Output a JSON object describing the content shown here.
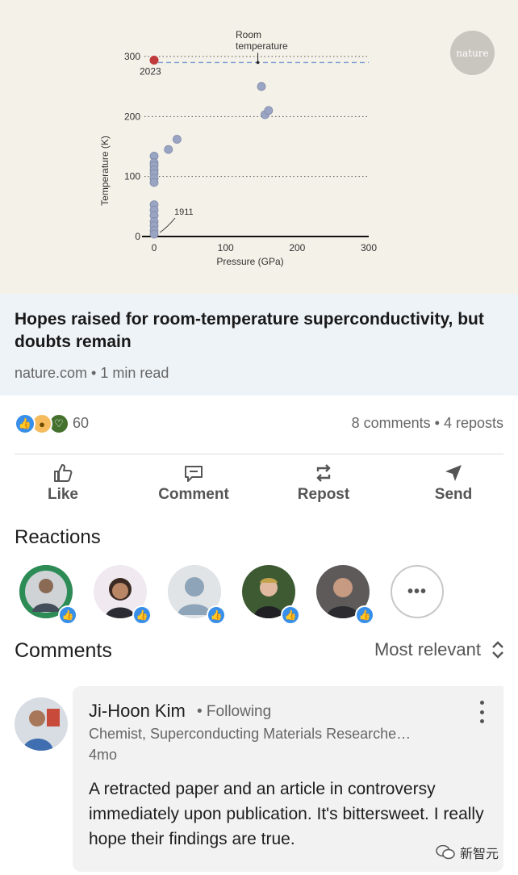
{
  "chart_data": {
    "type": "scatter",
    "xlabel": "Pressure (GPa)",
    "ylabel": "Temperature (K)",
    "xlim": [
      0,
      300
    ],
    "ylim": [
      0,
      300
    ],
    "x_ticks": [
      "0",
      "100",
      "200",
      "300"
    ],
    "y_ticks": [
      "0",
      "100",
      "200",
      "300"
    ],
    "grid": "dotted horizontal at 100, 200, 300",
    "reference_line": {
      "label": "Room temperature",
      "y": 290
    },
    "annotations": [
      {
        "label": "2023",
        "x": 0,
        "y": 294
      },
      {
        "label": "1911",
        "x": 0,
        "y": 4
      }
    ],
    "points": [
      {
        "x": 0,
        "y": 294,
        "highlight": true
      },
      {
        "x": 0,
        "y": 134
      },
      {
        "x": 0,
        "y": 123
      },
      {
        "x": 0,
        "y": 118
      },
      {
        "x": 0,
        "y": 111
      },
      {
        "x": 0,
        "y": 105
      },
      {
        "x": 0,
        "y": 97
      },
      {
        "x": 0,
        "y": 90
      },
      {
        "x": 0,
        "y": 53
      },
      {
        "x": 0,
        "y": 44
      },
      {
        "x": 0,
        "y": 35
      },
      {
        "x": 0,
        "y": 25
      },
      {
        "x": 0,
        "y": 18
      },
      {
        "x": 0,
        "y": 10
      },
      {
        "x": 0,
        "y": 4
      },
      {
        "x": 20,
        "y": 145
      },
      {
        "x": 32,
        "y": 162
      },
      {
        "x": 150,
        "y": 250
      },
      {
        "x": 155,
        "y": 203
      },
      {
        "x": 160,
        "y": 210
      }
    ],
    "colors": {
      "points": "#9aa5c4",
      "highlight": "#c0393b",
      "room_line": "#7b9cd1"
    }
  },
  "brand": {
    "logo_text": "nature"
  },
  "article": {
    "title": "Hopes raised for room-temperature superconductivity, but doubts remain",
    "source": "nature.com • 1 min read"
  },
  "social": {
    "reaction_count": "60",
    "reaction_icons": [
      "like-icon",
      "insightful-icon",
      "support-icon"
    ],
    "comment_stats": "8 comments • 4 reposts"
  },
  "actions": {
    "like": "Like",
    "comment": "Comment",
    "repost": "Repost",
    "send": "Send"
  },
  "reactions": {
    "title": "Reactions",
    "more": "•••"
  },
  "comments": {
    "title": "Comments",
    "sort_label": "Most relevant",
    "items": [
      {
        "name": "Ji-Hoon Kim",
        "relation": "• Following",
        "headline": "Chemist, Superconducting Materials Researche…",
        "time": "4mo",
        "text": "A retracted paper and an article in controversy immediately upon publication. It's bittersweet. I really hope their findings are true."
      }
    ]
  },
  "watermark": {
    "text": "新智元"
  },
  "colors": {
    "accent": "#378fe9",
    "text_secondary": "#666666",
    "preview_bg": "#f4f1e8",
    "info_bg": "#eef3f8"
  }
}
